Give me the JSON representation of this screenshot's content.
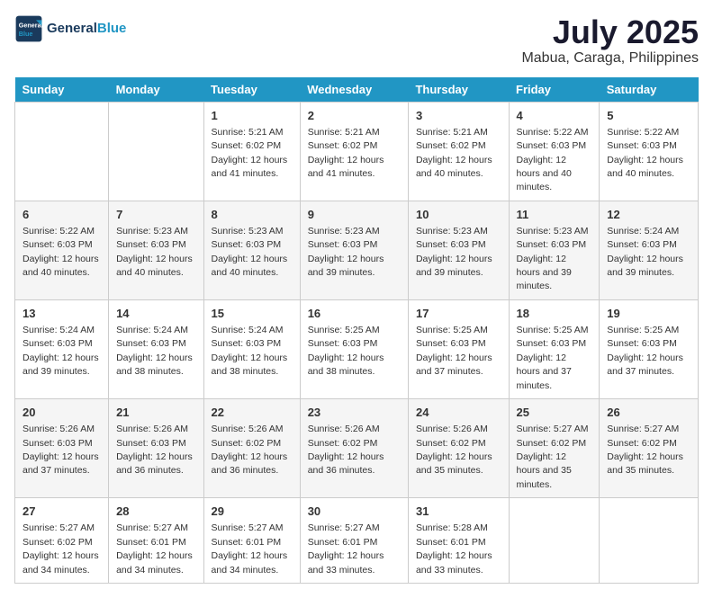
{
  "logo": {
    "line1": "General",
    "line2": "Blue"
  },
  "title": "July 2025",
  "subtitle": "Mabua, Caraga, Philippines",
  "days_header": [
    "Sunday",
    "Monday",
    "Tuesday",
    "Wednesday",
    "Thursday",
    "Friday",
    "Saturday"
  ],
  "weeks": [
    [
      {
        "day": "",
        "info": ""
      },
      {
        "day": "",
        "info": ""
      },
      {
        "day": "1",
        "info": "Sunrise: 5:21 AM\nSunset: 6:02 PM\nDaylight: 12 hours and 41 minutes."
      },
      {
        "day": "2",
        "info": "Sunrise: 5:21 AM\nSunset: 6:02 PM\nDaylight: 12 hours and 41 minutes."
      },
      {
        "day": "3",
        "info": "Sunrise: 5:21 AM\nSunset: 6:02 PM\nDaylight: 12 hours and 40 minutes."
      },
      {
        "day": "4",
        "info": "Sunrise: 5:22 AM\nSunset: 6:03 PM\nDaylight: 12 hours and 40 minutes."
      },
      {
        "day": "5",
        "info": "Sunrise: 5:22 AM\nSunset: 6:03 PM\nDaylight: 12 hours and 40 minutes."
      }
    ],
    [
      {
        "day": "6",
        "info": "Sunrise: 5:22 AM\nSunset: 6:03 PM\nDaylight: 12 hours and 40 minutes."
      },
      {
        "day": "7",
        "info": "Sunrise: 5:23 AM\nSunset: 6:03 PM\nDaylight: 12 hours and 40 minutes."
      },
      {
        "day": "8",
        "info": "Sunrise: 5:23 AM\nSunset: 6:03 PM\nDaylight: 12 hours and 40 minutes."
      },
      {
        "day": "9",
        "info": "Sunrise: 5:23 AM\nSunset: 6:03 PM\nDaylight: 12 hours and 39 minutes."
      },
      {
        "day": "10",
        "info": "Sunrise: 5:23 AM\nSunset: 6:03 PM\nDaylight: 12 hours and 39 minutes."
      },
      {
        "day": "11",
        "info": "Sunrise: 5:23 AM\nSunset: 6:03 PM\nDaylight: 12 hours and 39 minutes."
      },
      {
        "day": "12",
        "info": "Sunrise: 5:24 AM\nSunset: 6:03 PM\nDaylight: 12 hours and 39 minutes."
      }
    ],
    [
      {
        "day": "13",
        "info": "Sunrise: 5:24 AM\nSunset: 6:03 PM\nDaylight: 12 hours and 39 minutes."
      },
      {
        "day": "14",
        "info": "Sunrise: 5:24 AM\nSunset: 6:03 PM\nDaylight: 12 hours and 38 minutes."
      },
      {
        "day": "15",
        "info": "Sunrise: 5:24 AM\nSunset: 6:03 PM\nDaylight: 12 hours and 38 minutes."
      },
      {
        "day": "16",
        "info": "Sunrise: 5:25 AM\nSunset: 6:03 PM\nDaylight: 12 hours and 38 minutes."
      },
      {
        "day": "17",
        "info": "Sunrise: 5:25 AM\nSunset: 6:03 PM\nDaylight: 12 hours and 37 minutes."
      },
      {
        "day": "18",
        "info": "Sunrise: 5:25 AM\nSunset: 6:03 PM\nDaylight: 12 hours and 37 minutes."
      },
      {
        "day": "19",
        "info": "Sunrise: 5:25 AM\nSunset: 6:03 PM\nDaylight: 12 hours and 37 minutes."
      }
    ],
    [
      {
        "day": "20",
        "info": "Sunrise: 5:26 AM\nSunset: 6:03 PM\nDaylight: 12 hours and 37 minutes."
      },
      {
        "day": "21",
        "info": "Sunrise: 5:26 AM\nSunset: 6:03 PM\nDaylight: 12 hours and 36 minutes."
      },
      {
        "day": "22",
        "info": "Sunrise: 5:26 AM\nSunset: 6:02 PM\nDaylight: 12 hours and 36 minutes."
      },
      {
        "day": "23",
        "info": "Sunrise: 5:26 AM\nSunset: 6:02 PM\nDaylight: 12 hours and 36 minutes."
      },
      {
        "day": "24",
        "info": "Sunrise: 5:26 AM\nSunset: 6:02 PM\nDaylight: 12 hours and 35 minutes."
      },
      {
        "day": "25",
        "info": "Sunrise: 5:27 AM\nSunset: 6:02 PM\nDaylight: 12 hours and 35 minutes."
      },
      {
        "day": "26",
        "info": "Sunrise: 5:27 AM\nSunset: 6:02 PM\nDaylight: 12 hours and 35 minutes."
      }
    ],
    [
      {
        "day": "27",
        "info": "Sunrise: 5:27 AM\nSunset: 6:02 PM\nDaylight: 12 hours and 34 minutes."
      },
      {
        "day": "28",
        "info": "Sunrise: 5:27 AM\nSunset: 6:01 PM\nDaylight: 12 hours and 34 minutes."
      },
      {
        "day": "29",
        "info": "Sunrise: 5:27 AM\nSunset: 6:01 PM\nDaylight: 12 hours and 34 minutes."
      },
      {
        "day": "30",
        "info": "Sunrise: 5:27 AM\nSunset: 6:01 PM\nDaylight: 12 hours and 33 minutes."
      },
      {
        "day": "31",
        "info": "Sunrise: 5:28 AM\nSunset: 6:01 PM\nDaylight: 12 hours and 33 minutes."
      },
      {
        "day": "",
        "info": ""
      },
      {
        "day": "",
        "info": ""
      }
    ]
  ]
}
